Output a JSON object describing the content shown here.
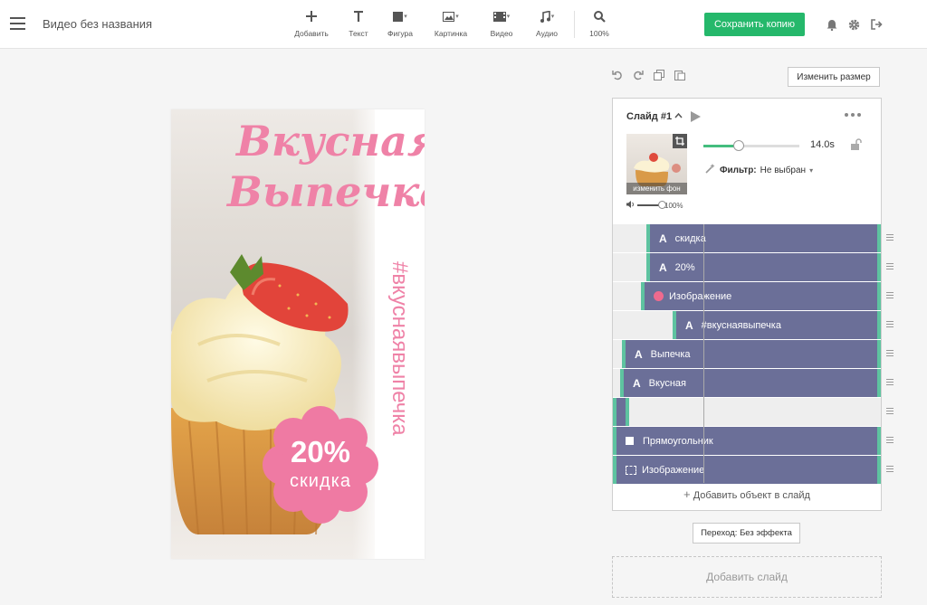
{
  "header": {
    "title": "Видео без названия",
    "tools": [
      {
        "label": "Добавить",
        "icon": "plus-icon"
      },
      {
        "label": "Текст",
        "icon": "text-icon"
      },
      {
        "label": "Фигура",
        "icon": "shape-icon"
      },
      {
        "label": "Картинка",
        "icon": "image-icon"
      },
      {
        "label": "Видео",
        "icon": "video-icon"
      },
      {
        "label": "Аудио",
        "icon": "music-icon"
      },
      {
        "label": "100%",
        "icon": "zoom-icon"
      }
    ],
    "save_label": "Сохранить копию",
    "accent": "#25b86b"
  },
  "canvas": {
    "headline_1": "Вкусная",
    "headline_2": "Выпечка",
    "hashtag": "#вкуснаявыпечка",
    "badge_value": "20%",
    "badge_label": "скидка",
    "pink": "#ef82a7"
  },
  "toolbar_right": {
    "resize_label": "Изменить размер"
  },
  "slide": {
    "title": "Слайд #1",
    "bg_button": "изменить фон",
    "volume": "100%",
    "duration": "14.0s",
    "duration_fraction": 0.37,
    "filter_label": "Фильтр:",
    "filter_value": "Не выбран",
    "layers": [
      {
        "label": "скидка",
        "type": "text"
      },
      {
        "label": "20%",
        "type": "text"
      },
      {
        "label": "Изображение",
        "type": "image-dot"
      },
      {
        "label": "#вкуснаявыпечка",
        "type": "text"
      },
      {
        "label": "Выпечка",
        "type": "text"
      },
      {
        "label": "Вкусная",
        "type": "text"
      },
      {
        "label": "",
        "type": "empty"
      },
      {
        "label": "Прямоугольник",
        "type": "rect"
      },
      {
        "label": "Изображение",
        "type": "image-frame"
      }
    ],
    "add_object": "Добавить объект в слайд"
  },
  "transition_label": "Переход: Без эффекта",
  "add_slide": "Добавить слайд"
}
